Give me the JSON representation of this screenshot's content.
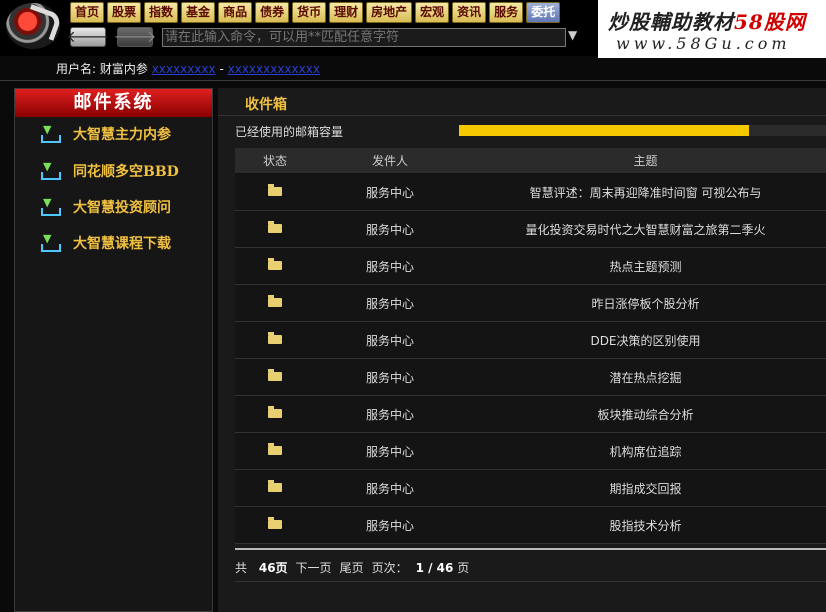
{
  "nav": {
    "buttons": [
      "首页",
      "股票",
      "指数",
      "基金",
      "商品",
      "债券",
      "货币",
      "理财",
      "房地产",
      "宏观",
      "资讯",
      "服务",
      "委托"
    ],
    "command_placeholder": "请在此输入命令，可以用**匹配任意字符"
  },
  "watermark": {
    "line1_prefix": "炒股輔助教材",
    "line1_brand": "58股网",
    "line2": "www.58Gu.com"
  },
  "user": {
    "label": "用户名: 财富内参",
    "link1": "xxxxxxxxx",
    "sep": "-",
    "link2": "xxxxxxxxxxxxx"
  },
  "sidebar": {
    "title": "邮件系统",
    "items": [
      {
        "label": "大智慧主力内参"
      },
      {
        "label": "同花顺多空BBD"
      },
      {
        "label": "大智慧投资顾问"
      },
      {
        "label": "大智慧课程下载"
      }
    ]
  },
  "inbox": {
    "title": "收件箱",
    "capacity_label": "已经使用的邮箱容量",
    "capacity_used_fraction": 0.79,
    "columns": {
      "status": "状态",
      "sender": "发件人",
      "subject": "主题"
    },
    "rows": [
      {
        "sender": "服务中心",
        "subject": "智慧评述：周末再迎降准时间窗 可视公布与"
      },
      {
        "sender": "服务中心",
        "subject": "量化投资交易时代之大智慧财富之旅第二季火"
      },
      {
        "sender": "服务中心",
        "subject": "热点主题预测"
      },
      {
        "sender": "服务中心",
        "subject": "昨日涨停板个股分析"
      },
      {
        "sender": "服务中心",
        "subject": "DDE决策的区别使用"
      },
      {
        "sender": "服务中心",
        "subject": "潜在热点挖掘"
      },
      {
        "sender": "服务中心",
        "subject": "板块推动综合分析"
      },
      {
        "sender": "服务中心",
        "subject": "机构席位追踪"
      },
      {
        "sender": "服务中心",
        "subject": "期指成交回报"
      },
      {
        "sender": "服务中心",
        "subject": "股指技术分析"
      }
    ],
    "pager": {
      "total_prefix": "共",
      "total_pages": "46页",
      "next": "下一页",
      "last": "尾页",
      "page_label": "页次：",
      "page_value": "1 / 46",
      "page_suffix": "页"
    }
  }
}
